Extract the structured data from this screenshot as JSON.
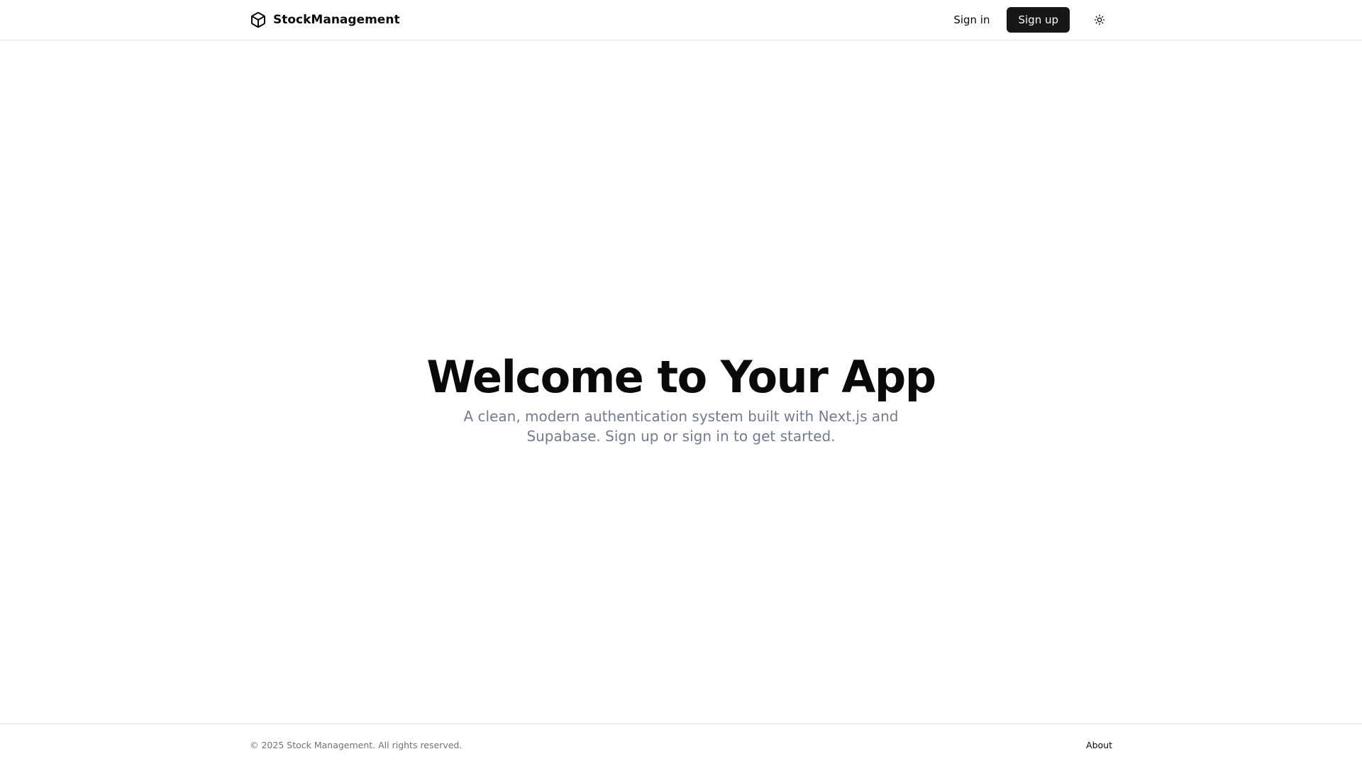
{
  "header": {
    "brand_name": "StockManagement",
    "brand_icon": "box-icon",
    "sign_in_label": "Sign in",
    "sign_up_label": "Sign up",
    "theme_toggle_icon": "sun-icon"
  },
  "hero": {
    "title": "Welcome to Your App",
    "subtitle": "A clean, modern authentication system built with Next.js and Supabase. Sign up or sign in to get started."
  },
  "footer": {
    "copyright": "© 2025 Stock Management. All rights reserved.",
    "about_label": "About"
  },
  "colors": {
    "primary_button_bg": "#171717",
    "primary_button_text": "#fafafa",
    "muted_text": "#737b8c",
    "border": "#e5e5e5",
    "background": "#ffffff"
  }
}
